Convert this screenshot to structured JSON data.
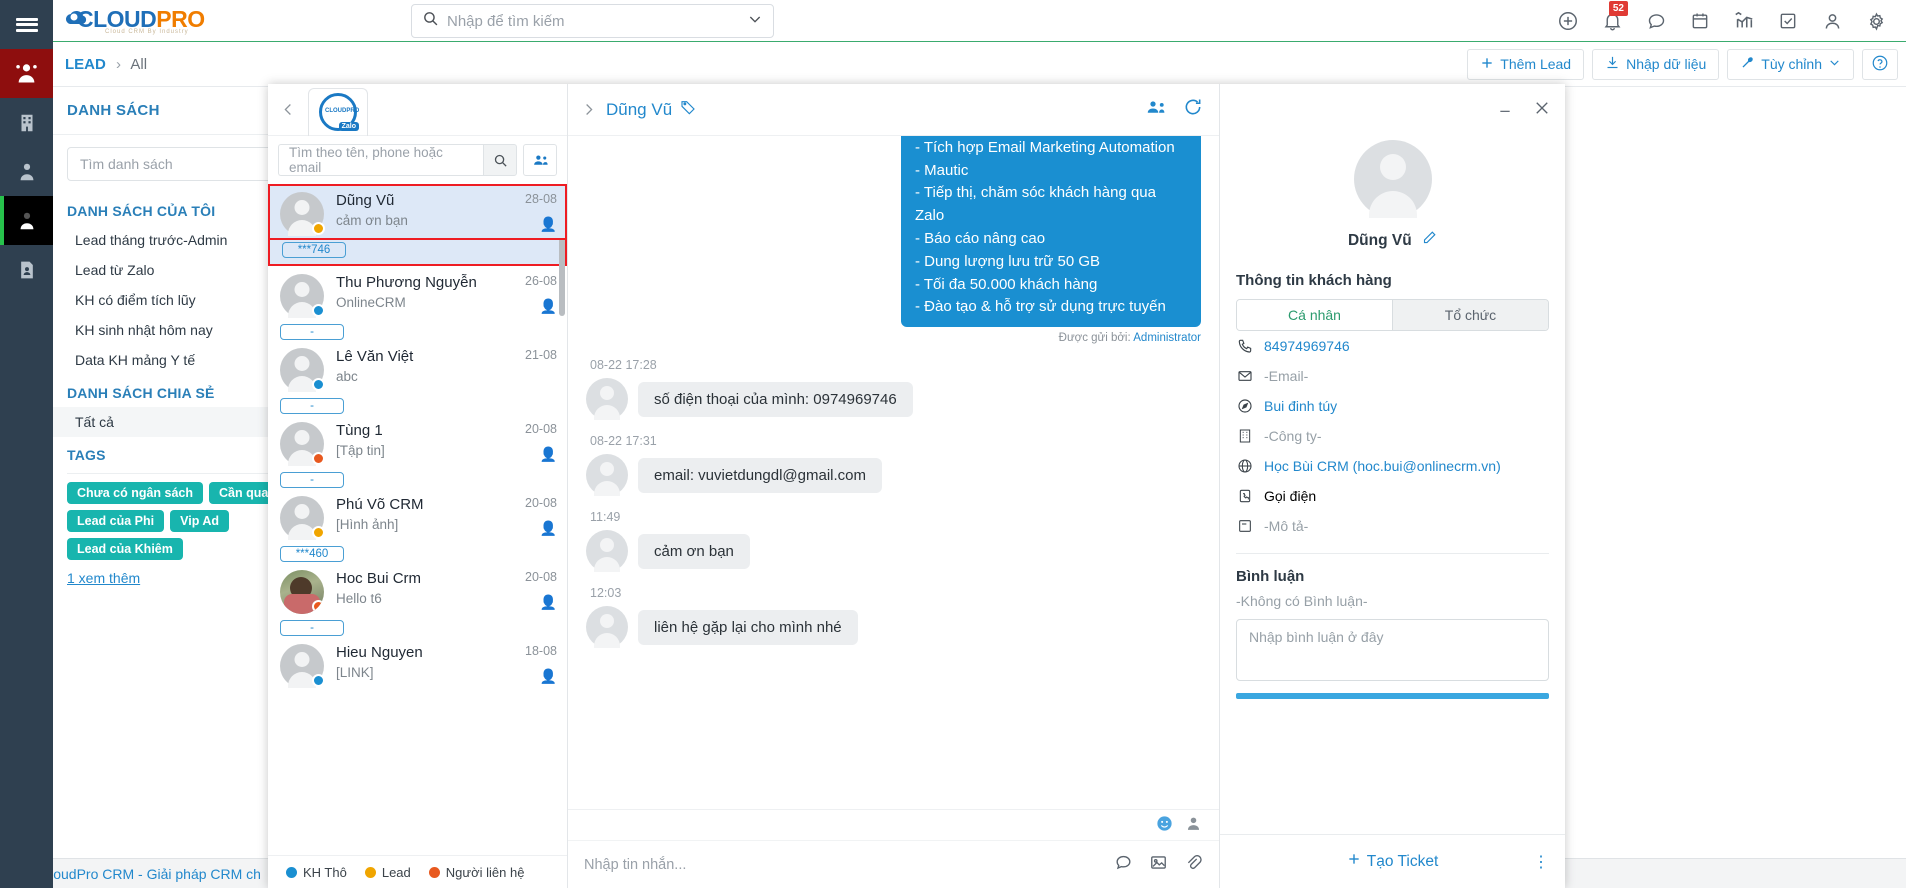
{
  "topbar": {
    "brand_main": "CLOUD",
    "brand_accent": "PRO",
    "brand_tagline": "Cloud CRM By Industry",
    "search_placeholder": "Nhập để tìm kiếm",
    "notification_count": "52"
  },
  "breadcrumb": {
    "root": "LEAD",
    "separator": "›",
    "current": "All"
  },
  "actions": {
    "add_lead": "Thêm Lead",
    "import_data": "Nhập dữ liệu",
    "customize": "Tùy chỉnh",
    "help": "?"
  },
  "list_panel": {
    "title": "DANH SÁCH",
    "add_label": "+",
    "search_placeholder": "Tìm danh sách",
    "my_lists_heading": "DANH SÁCH CỦA TÔI",
    "my_lists": [
      "Lead tháng trước-Admin",
      "Lead từ Zalo",
      "KH có điểm tích lũy",
      "KH sinh nhật hôm nay",
      "Data KH mảng Y tế"
    ],
    "shared_heading": "DANH SÁCH CHIA SẺ",
    "shared": [
      "Tất cả"
    ],
    "tags_heading": "TAGS",
    "tags": [
      "Chưa có ngân sách",
      "Cần quan tâm",
      "Lead của Phi",
      "Vip Ad",
      "Lead của Khiêm"
    ],
    "see_more": "1  xem thêm"
  },
  "statusbar": {
    "text": "CloudPro CRM - Giải pháp CRM ch"
  },
  "zalo": {
    "account_logo_label": "Zalo",
    "contact_search_placeholder": "Tìm theo tên, phone hoặc email",
    "contacts": [
      {
        "name": "Dũng Vũ",
        "preview": "cảm ơn bạn",
        "date": "28-08",
        "dot": "#f0a500",
        "chip": "***746",
        "emoji": "👤",
        "active": true,
        "photo": false
      },
      {
        "name": "Thu Phương Nguyễn",
        "preview": "OnlineCRM",
        "date": "26-08",
        "dot": "#1a8fd1",
        "chip": "-",
        "emoji": "👤",
        "active": false,
        "photo": false
      },
      {
        "name": "Lê Văn Việt",
        "preview": "abc",
        "date": "21-08",
        "dot": "#1a8fd1",
        "chip": "-",
        "emoji": "",
        "active": false,
        "photo": false
      },
      {
        "name": "Tùng 1",
        "preview": "[Tập tin]",
        "date": "20-08",
        "dot": "#e8591f",
        "chip": "-",
        "emoji": "👤",
        "active": false,
        "photo": false
      },
      {
        "name": "Phú Võ CRM",
        "preview": "[Hình ảnh]",
        "date": "20-08",
        "dot": "#f0a500",
        "chip": "***460",
        "emoji": "👤",
        "active": false,
        "photo": false
      },
      {
        "name": "Hoc Bui Crm",
        "preview": "Hello t6",
        "date": "20-08",
        "dot": "#e8591f",
        "chip": "-",
        "emoji": "👤",
        "active": false,
        "photo": true
      },
      {
        "name": "Hieu Nguyen",
        "preview": "[LINK]",
        "date": "18-08",
        "dot": "#1a8fd1",
        "chip": "",
        "emoji": "👤",
        "active": false,
        "photo": false
      }
    ],
    "legend": [
      {
        "label": "KH Thô",
        "color": "#1a8fd1"
      },
      {
        "label": "Lead",
        "color": "#f0a500"
      },
      {
        "label": "Người liên hệ",
        "color": "#e8591f"
      }
    ],
    "chat": {
      "title": "Dũng Vũ",
      "outgoing_message": "- Tích hợp Zalo Official Account\n- Tích hợp Email Marketing Automation\n- Mautic\n- Tiếp thị, chăm sóc khách hàng qua Zalo\n- Báo cáo nâng cao\n- Dung lượng lưu trữ 50 GB\n- Tối đa 50.000 khách hàng\n- Đào tạo & hỗ trợ sử dụng trực tuyến",
      "sent_by_label": "Được gửi bởi:",
      "sent_by_user": "Administrator",
      "messages": [
        {
          "time": "08-22 17:28",
          "text": "số điện thoại của mình: 0974969746"
        },
        {
          "time": "08-22 17:31",
          "text": "email: vuvietdungdl@gmail.com"
        },
        {
          "time": "11:49",
          "text": "cảm ơn bạn"
        },
        {
          "time": "12:03",
          "text": "liên hệ gặp lại cho mình nhé"
        }
      ],
      "input_placeholder": "Nhập tin nhắn..."
    },
    "info": {
      "name": "Dũng Vũ",
      "section_title": "Thông tin khách hàng",
      "tab_personal": "Cá nhân",
      "tab_org": "Tổ chức",
      "fields": [
        {
          "icon": "phone-icon",
          "value": "84974969746",
          "link": true
        },
        {
          "icon": "email-icon",
          "value": "-Email-",
          "link": false
        },
        {
          "icon": "compass-icon",
          "value": "Bui đinh túy",
          "link": true
        },
        {
          "icon": "building-icon",
          "value": "-Công ty-",
          "link": false
        },
        {
          "icon": "globe-icon",
          "value": "Học Bùi CRM (hoc.bui@onlinecrm.vn)",
          "link": true
        },
        {
          "icon": "call-icon",
          "value": "Gọi điện",
          "link": false
        },
        {
          "icon": "note-icon",
          "value": "-Mô tả-",
          "link": false
        }
      ],
      "comments_title": "Bình luận",
      "comments_empty": "-Không có Bình luận-",
      "comment_placeholder": "Nhập bình luận ở đây",
      "create_ticket": "Tạo Ticket"
    }
  }
}
